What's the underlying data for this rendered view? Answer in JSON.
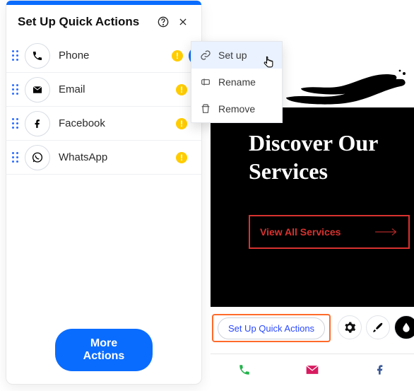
{
  "panel": {
    "title": "Set Up Quick Actions",
    "items": [
      {
        "label": "Phone",
        "icon": "phone-icon"
      },
      {
        "label": "Email",
        "icon": "email-icon"
      },
      {
        "label": "Facebook",
        "icon": "facebook-icon"
      },
      {
        "label": "WhatsApp",
        "icon": "whatsapp-icon"
      }
    ],
    "more_button": "More Actions"
  },
  "dropdown": {
    "items": [
      {
        "label": "Set up",
        "icon": "link-icon"
      },
      {
        "label": "Rename",
        "icon": "rename-icon"
      },
      {
        "label": "Remove",
        "icon": "trash-icon"
      }
    ]
  },
  "preview": {
    "hero_title": "Discover Our Services",
    "cta": "View All Services",
    "pill": "Set Up Quick Actions"
  },
  "colors": {
    "accent": "#0a6cff",
    "cta_red": "#d8322f",
    "select_orange": "#ff6a2a",
    "envelope_pink": "#d81b60",
    "phone_green": "#23b24b",
    "fb_blue": "#3b5998"
  }
}
